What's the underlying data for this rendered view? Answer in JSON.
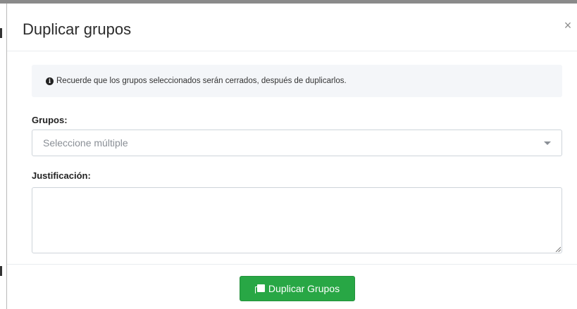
{
  "modal": {
    "title": "Duplicar grupos",
    "close_symbol": "×",
    "alert": {
      "icon": "info-circle-icon",
      "text": "Recuerde que los grupos seleccionados serán cerrados, después de duplicarlos."
    },
    "groups_field": {
      "label": "Grupos:",
      "placeholder": "Seleccione múltiple",
      "value": ""
    },
    "justification_field": {
      "label": "Justificación:",
      "value": ""
    },
    "footer": {
      "submit_label": "Duplicar Grupos",
      "submit_icon": "copy-icon",
      "submit_color": "#28a745"
    }
  }
}
